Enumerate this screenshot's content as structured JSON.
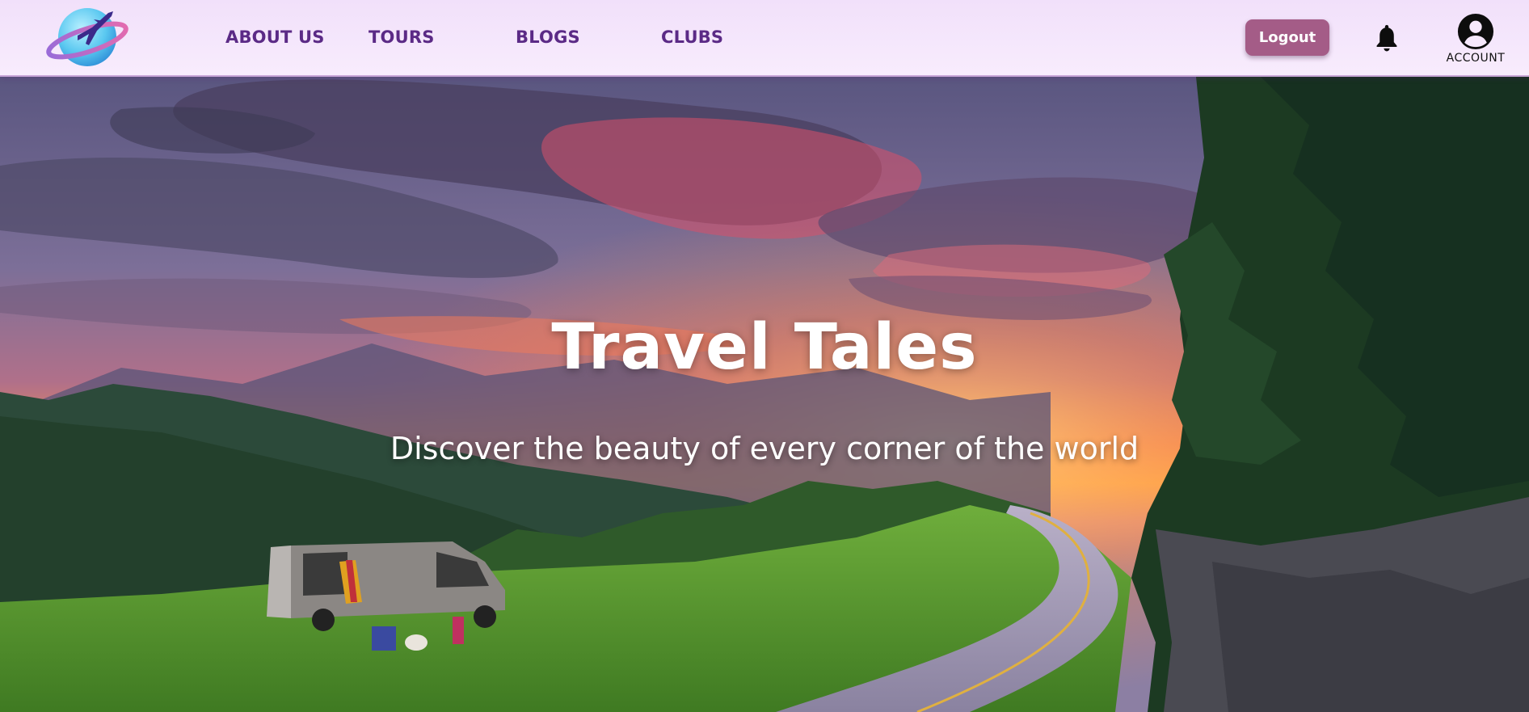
{
  "header": {
    "logo_icon": "airplane-globe-logo",
    "nav": [
      {
        "label": "ABOUT US"
      },
      {
        "label": "TOURS"
      },
      {
        "label": "BLOGS"
      },
      {
        "label": "CLUBS"
      }
    ],
    "logout_label": "Logout",
    "notification_icon": "bell-icon",
    "account_icon": "user-circle-icon",
    "account_label": "ACCOUNT"
  },
  "hero": {
    "title": "Travel Tales",
    "subtitle": "Discover the beauty of every corner of the world",
    "background": "sunset-mountain-road-campervan-photo"
  },
  "colors": {
    "nav_text": "#5b2a86",
    "header_bg": "#f3e4fb",
    "logout_bg": "#a45c87",
    "hero_text": "#ffffff"
  }
}
